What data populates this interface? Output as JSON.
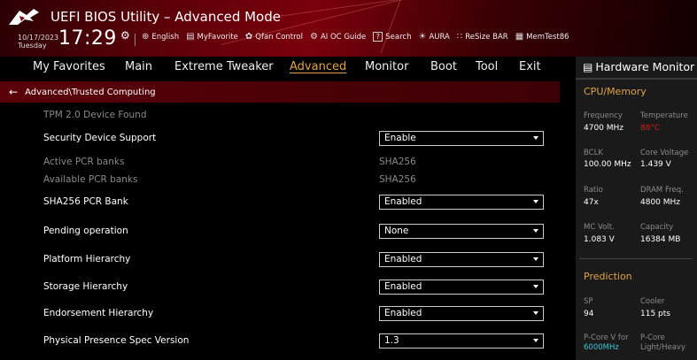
{
  "header": {
    "title": "UEFI BIOS Utility – Advanced Mode",
    "date": "10/17/2023",
    "weekday": "Tuesday",
    "time": "17:29",
    "toolbar": [
      {
        "icon": "globe-icon",
        "glyph": "⊕",
        "label": "English"
      },
      {
        "icon": "favorite-icon",
        "glyph": "▤",
        "label": "MyFavorite"
      },
      {
        "icon": "fan-icon",
        "glyph": "✿",
        "label": "Qfan Control"
      },
      {
        "icon": "ai-oc-icon",
        "glyph": "⚙",
        "label": "AI OC Guide"
      },
      {
        "icon": "search-icon",
        "glyph": "?",
        "label": "Search"
      },
      {
        "icon": "aura-icon",
        "glyph": "☀",
        "label": "AURA"
      },
      {
        "icon": "resize-bar-icon",
        "glyph": "∷",
        "label": "ReSize BAR"
      },
      {
        "icon": "memtest-icon",
        "glyph": "▦",
        "label": "MemTest86"
      }
    ]
  },
  "nav": {
    "items": [
      "My Favorites",
      "Main",
      "Extreme Tweaker",
      "Advanced",
      "Monitor",
      "Boot",
      "Tool",
      "Exit"
    ],
    "active": "Advanced"
  },
  "breadcrumb": "Advanced\\Trusted Computing",
  "rows": [
    {
      "label": "TPM 2.0 Device Found",
      "muted": true
    },
    {
      "label": "Security Device Support",
      "dropdown": "Enable"
    },
    {
      "label": "Active PCR banks",
      "muted": true,
      "value": "SHA256"
    },
    {
      "label": "Available PCR banks",
      "muted": true,
      "value": "SHA256"
    },
    {
      "label": "SHA256 PCR Bank",
      "dropdown": "Enabled"
    },
    {
      "label": "Pending operation",
      "dropdown": "None"
    },
    {
      "label": "Platform Hierarchy",
      "dropdown": "Enabled"
    },
    {
      "label": "Storage Hierarchy",
      "dropdown": "Enabled"
    },
    {
      "label": "Endorsement Hierarchy",
      "dropdown": "Enabled"
    },
    {
      "label": "Physical Presence Spec Version",
      "dropdown": "1.3"
    }
  ],
  "hardware_monitor": {
    "title": "Hardware Monitor",
    "cpu_memory_label": "CPU/Memory",
    "frequency_label": "Frequency",
    "frequency": "4700 MHz",
    "temperature_label": "Temperature",
    "temperature": "88°C",
    "bclk_label": "BCLK",
    "bclk": "100.00 MHz",
    "core_voltage_label": "Core Voltage",
    "core_voltage": "1.439 V",
    "ratio_label": "Ratio",
    "ratio": "47x",
    "dram_freq_label": "DRAM Freq.",
    "dram_freq": "4800 MHz",
    "mc_volt_label": "MC Volt.",
    "mc_volt": "1.083 V",
    "capacity_label": "Capacity",
    "capacity": "16384 MB",
    "prediction_label": "Prediction",
    "sp_label": "SP",
    "sp": "94",
    "cooler_label": "Cooler",
    "cooler": "115 pts",
    "pcore_v_label": "P-Core V for",
    "pcore_v_freq": "6000MHz",
    "pcore_label": "P-Core",
    "pcore_mode": "Light/Heavy",
    "colors": {
      "accent": "#e0a24a",
      "danger": "#d41e1e",
      "cyan": "#3ac6d8"
    }
  }
}
